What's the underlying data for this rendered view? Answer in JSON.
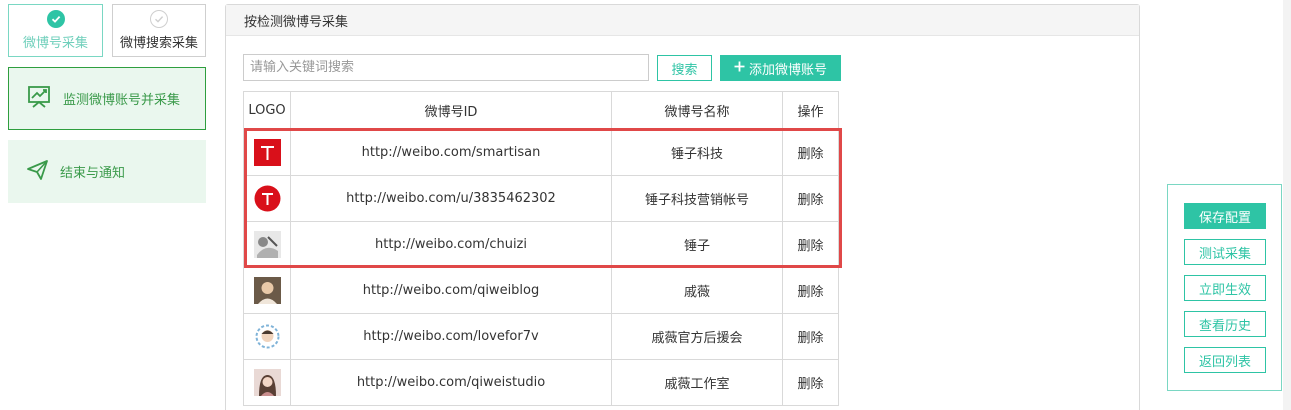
{
  "mode_tabs": {
    "weibo_collect": "微博号采集",
    "weibo_search_collect": "微博搜索采集"
  },
  "steps": {
    "monitor": "监测微博账号并采集",
    "finish": "结束与通知"
  },
  "panel": {
    "title": "按检测微博号采集",
    "search_placeholder": "请输入关键词搜索",
    "search_button": "搜索",
    "add_button": "添加微博账号"
  },
  "table": {
    "headers": [
      "LOGO",
      "微博号ID",
      "微博号名称",
      "操作"
    ],
    "rows": [
      {
        "id": "http://weibo.com/smartisan",
        "name": "锤子科技",
        "action": "删除"
      },
      {
        "id": "http://weibo.com/u/3835462302",
        "name": "锤子科技营销帐号",
        "action": "删除"
      },
      {
        "id": "http://weibo.com/chuizi",
        "name": "锤子",
        "action": "删除"
      },
      {
        "id": "http://weibo.com/qiweiblog",
        "name": "戚薇",
        "action": "删除"
      },
      {
        "id": "http://weibo.com/lovefor7v",
        "name": "戚薇官方后援会",
        "action": "删除"
      },
      {
        "id": "http://weibo.com/qiweistudio",
        "name": "戚薇工作室",
        "action": "删除"
      }
    ]
  },
  "actions": {
    "save": "保存配置",
    "test": "测试采集",
    "apply": "立即生效",
    "history": "查看历史",
    "back": "返回列表"
  },
  "colors": {
    "accent": "#2ec4a5",
    "step_bg": "#eaf7ee",
    "step_text": "#3a9a4a",
    "highlight": "#e04848"
  }
}
